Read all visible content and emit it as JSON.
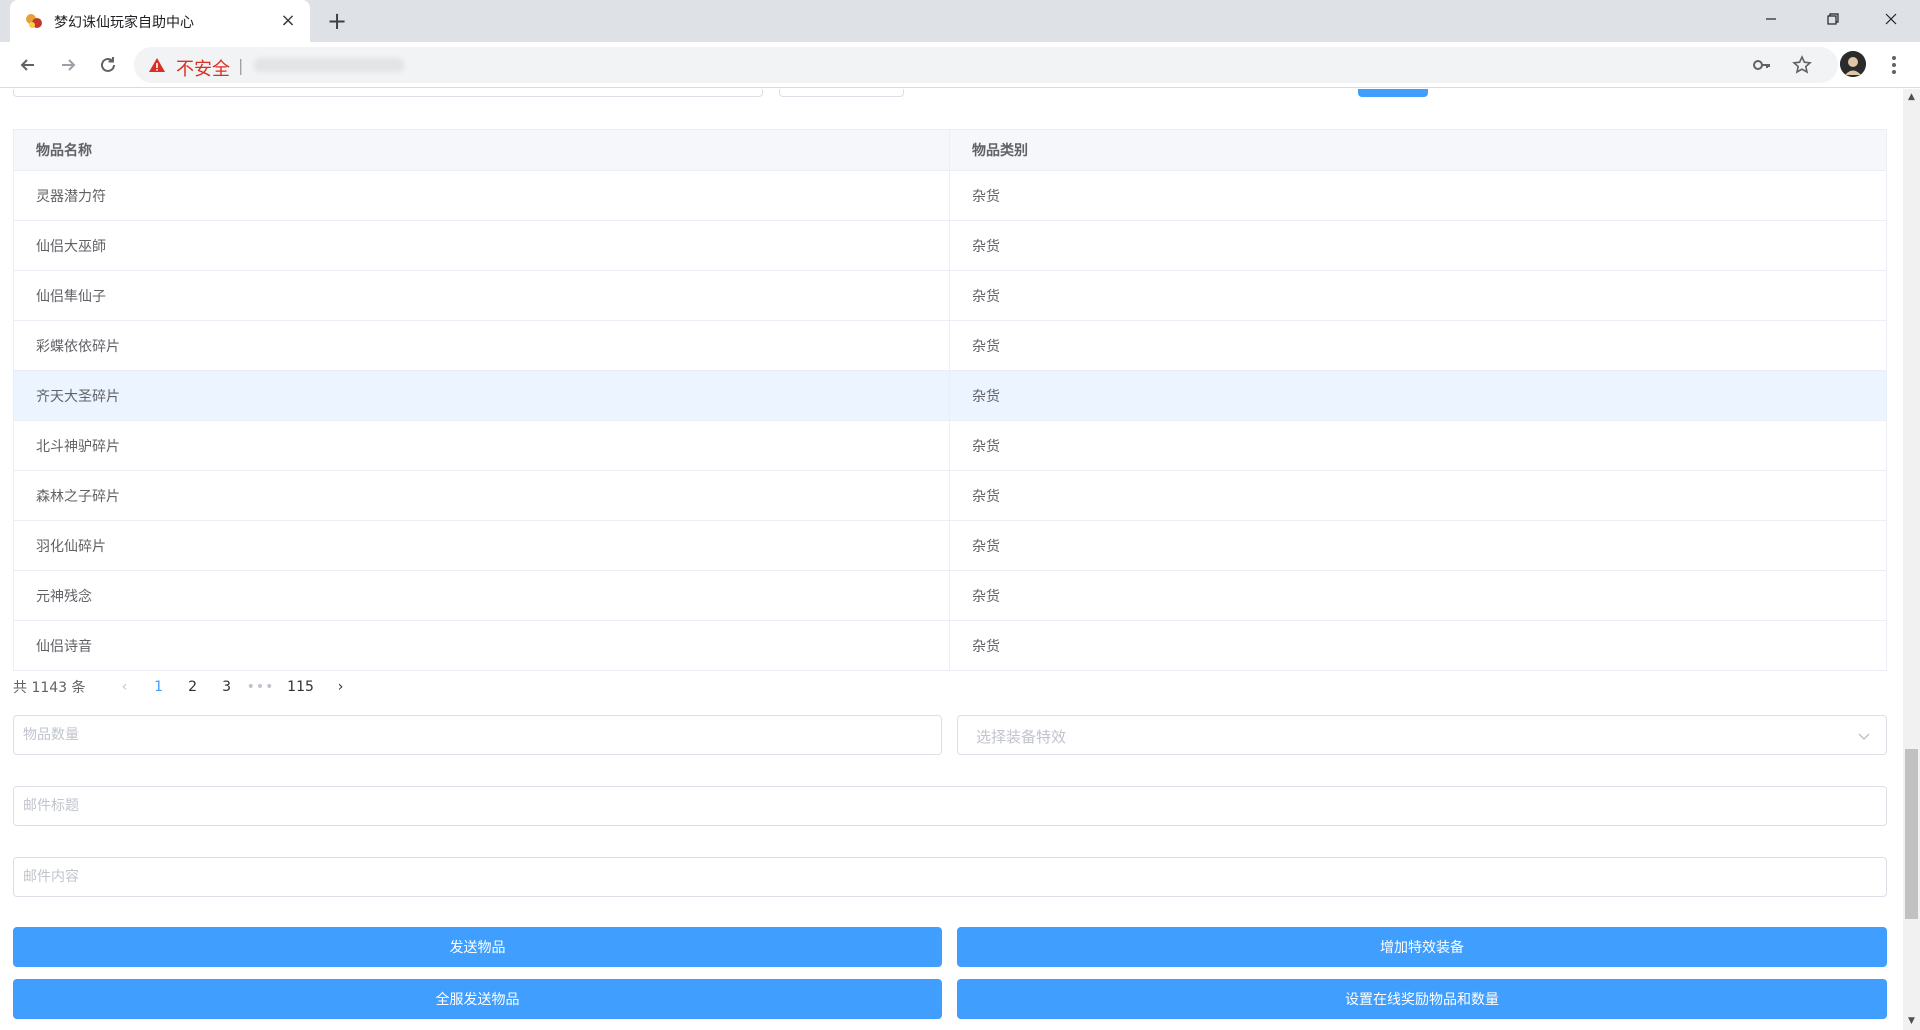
{
  "browser": {
    "tab_title": "梦幻诛仙玩家自助中心",
    "tab_close": "×",
    "new_tab": "+",
    "security_label": "不安全",
    "url_separator": "|"
  },
  "colors": {
    "primary": "#409eff",
    "row_hover": "#ecf5ff",
    "warning": "#d93025"
  },
  "table": {
    "columns": [
      "物品名称",
      "物品类别"
    ],
    "rows": [
      [
        "灵器潜力符",
        "杂货"
      ],
      [
        "仙侣大巫師",
        "杂货"
      ],
      [
        "仙侣隼仙子",
        "杂货"
      ],
      [
        "彩蝶依依碎片",
        "杂货"
      ],
      [
        "齐天大圣碎片",
        "杂货"
      ],
      [
        "北斗神驴碎片",
        "杂货"
      ],
      [
        "森林之子碎片",
        "杂货"
      ],
      [
        "羽化仙碎片",
        "杂货"
      ],
      [
        "元神残念",
        "杂货"
      ],
      [
        "仙侣诗音",
        "杂货"
      ]
    ]
  },
  "pagination": {
    "total_label": "共 1143 条",
    "prev": "‹",
    "pages": [
      "1",
      "2",
      "3"
    ],
    "more": "•••",
    "last_page": "115",
    "next": "›",
    "current": "1"
  },
  "form": {
    "quantity_placeholder": "物品数量",
    "effect_select_placeholder": "选择装备特效",
    "mail_title_placeholder": "邮件标题",
    "mail_content_placeholder": "邮件内容"
  },
  "buttons": {
    "send_item": "发送物品",
    "add_effect_equipment": "增加特效装备",
    "send_all_servers": "全服发送物品",
    "set_online_reward": "设置在线奖励物品和数量"
  }
}
